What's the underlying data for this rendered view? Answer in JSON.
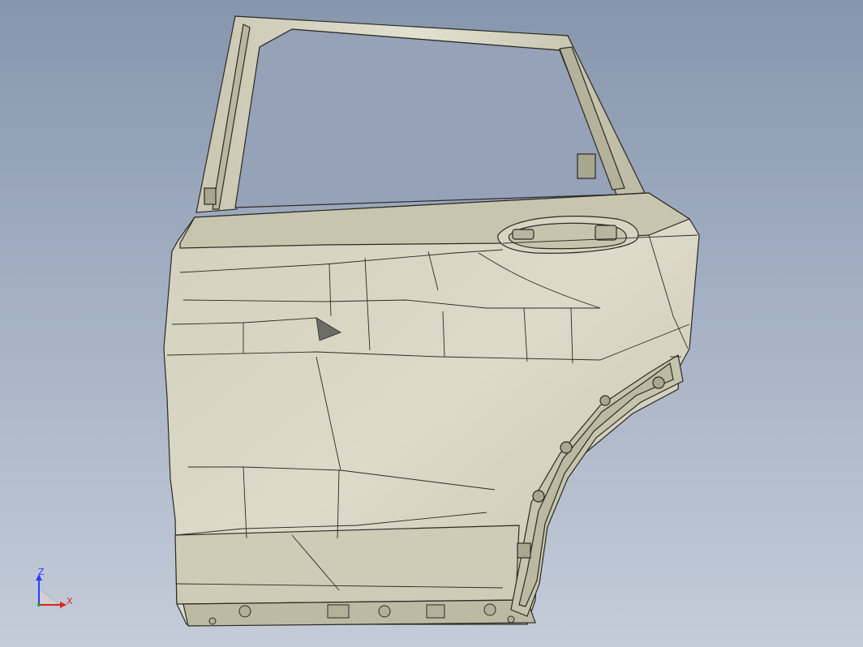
{
  "viewport": {
    "view_name": "3d-model-viewport",
    "model": "rear-door-panel"
  },
  "triad": {
    "z_label": "Z",
    "x_label": "X",
    "z_color": "#2a3cff",
    "x_color": "#e02020",
    "y_color": "#20a020"
  },
  "colors": {
    "background_top": "#8696ac",
    "background_bottom": "#c4ccd8",
    "panel_fill": "#d9d6c4",
    "panel_shade": "#c6c3ad",
    "edge_line": "#2a2a24"
  }
}
